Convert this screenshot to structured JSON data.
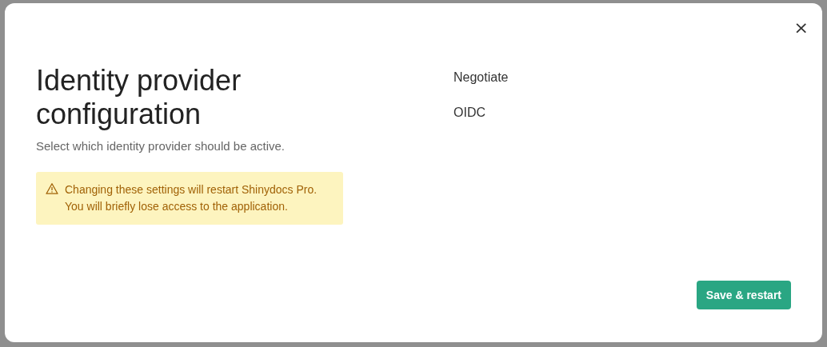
{
  "dialog": {
    "title": "Identity provider configuration",
    "subtitle": "Select which identity provider should be active.",
    "close": "×",
    "warning": {
      "lines": [
        "Changing these settings will restart Shinydocs Pro.",
        "You will briefly lose access to the application."
      ]
    },
    "providers": [
      {
        "label": "Negotiate"
      },
      {
        "label": "OIDC"
      }
    ],
    "buttons": [
      {
        "label": "Save & restart"
      }
    ]
  }
}
